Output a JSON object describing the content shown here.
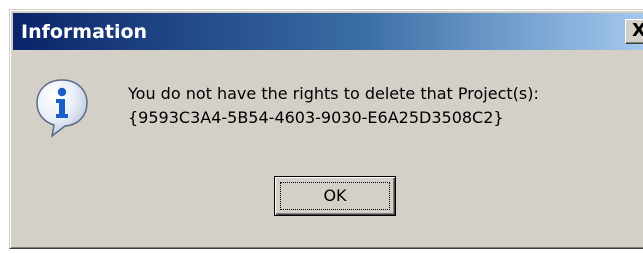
{
  "dialog": {
    "title": "Information",
    "close_label": "X",
    "message_lines": [
      "You do not have the rights to delete that Project(s):",
      "{9593C3A4-5B54-4603-9030-E6A25D3508C2}"
    ],
    "ok_label": "OK",
    "icon": "information-icon"
  },
  "colors": {
    "titlebar_start": "#0a246a",
    "titlebar_end": "#a6caf0",
    "window_face": "#d4d0c8",
    "icon_blue": "#1a5fc8"
  }
}
